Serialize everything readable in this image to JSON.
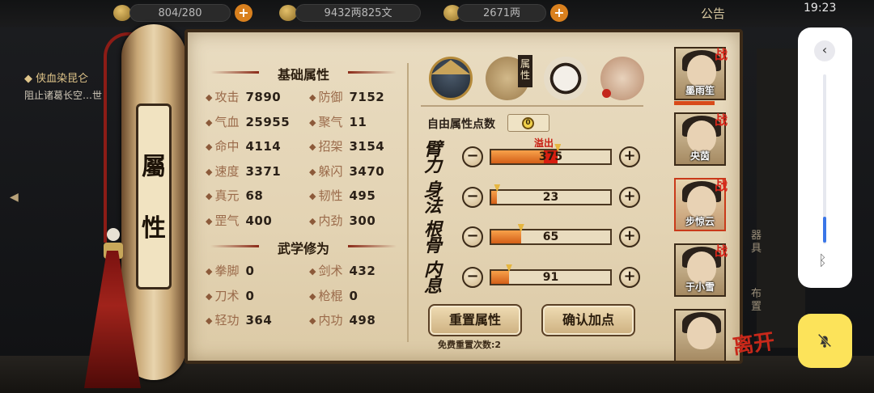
{
  "topbar": {
    "res1": "804/280",
    "money": "9432两825文",
    "gold": "2671两",
    "notice": "公告",
    "clock": "19:23"
  },
  "quest": {
    "title": "侠血染昆仑",
    "desc": "阻止诸葛长空…世"
  },
  "scroll": {
    "tag_top": "屬",
    "tag_bottom": "性"
  },
  "basic": {
    "title": "基础属性",
    "stats": [
      {
        "label": "攻击",
        "value": "7890"
      },
      {
        "label": "防御",
        "value": "7152"
      },
      {
        "label": "气血",
        "value": "25955"
      },
      {
        "label": "聚气",
        "value": "11"
      },
      {
        "label": "命中",
        "value": "4114"
      },
      {
        "label": "招架",
        "value": "3154"
      },
      {
        "label": "速度",
        "value": "3371"
      },
      {
        "label": "躲闪",
        "value": "3470"
      },
      {
        "label": "真元",
        "value": "68"
      },
      {
        "label": "韧性",
        "value": "495"
      },
      {
        "label": "罡气",
        "value": "400"
      },
      {
        "label": "内劲",
        "value": "300"
      }
    ]
  },
  "martial": {
    "title": "武学修为",
    "stats": [
      {
        "label": "拳脚",
        "value": "0"
      },
      {
        "label": "剑术",
        "value": "432"
      },
      {
        "label": "刀术",
        "value": "0"
      },
      {
        "label": "枪棍",
        "value": "0"
      },
      {
        "label": "轻功",
        "value": "364"
      },
      {
        "label": "内功",
        "value": "498"
      }
    ]
  },
  "tabs": {
    "badge": "属性"
  },
  "free_points": {
    "label": "自由属性点数",
    "value": "0"
  },
  "attributes": [
    {
      "name": "臂力",
      "value": "375",
      "fill": 0.44,
      "over": 0.12,
      "overflow_label": "溢出"
    },
    {
      "name": "身法",
      "value": "23",
      "fill": 0.05,
      "over": 0
    },
    {
      "name": "根骨",
      "value": "65",
      "fill": 0.25,
      "over": 0
    },
    {
      "name": "内息",
      "value": "91",
      "fill": 0.15,
      "over": 0
    }
  ],
  "buttons": {
    "reset": "重置属性",
    "confirm": "确认加点",
    "free_reset": "免费重置次数:2"
  },
  "characters": [
    {
      "name": "墨雨笙",
      "tag": "战"
    },
    {
      "name": "央茵",
      "tag": "战"
    },
    {
      "name": "步惊云",
      "tag": "战"
    },
    {
      "name": "于小雪",
      "tag": "战"
    },
    {
      "name": "",
      "tag": ""
    }
  ],
  "leave": "离开",
  "overlay": {
    "volume_level": 0.15
  },
  "colors": {
    "accent_red": "#d81e10",
    "bar_orange": "#d46018",
    "overlay_yellow": "#fce35a"
  }
}
